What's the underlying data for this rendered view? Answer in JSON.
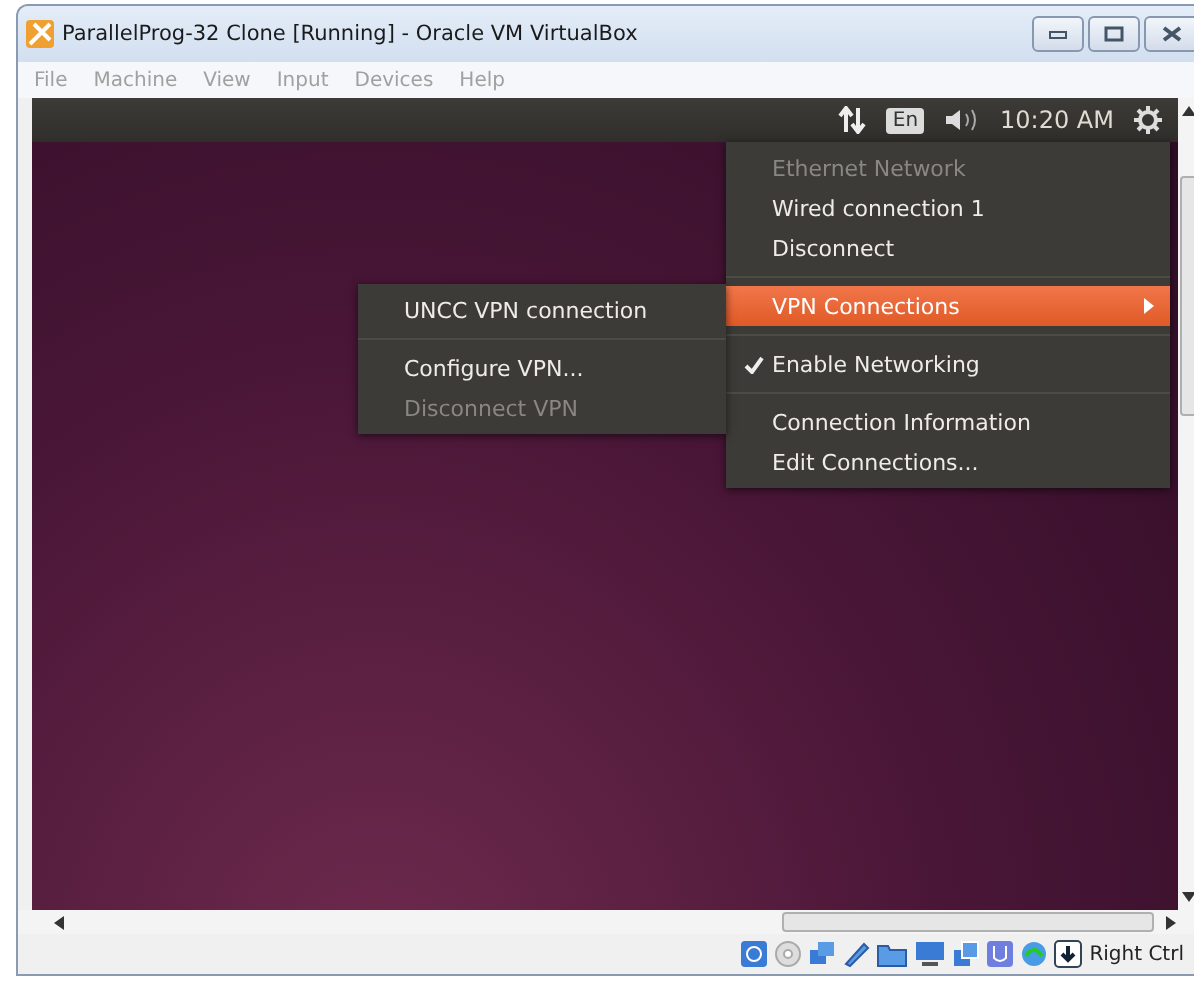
{
  "window": {
    "title": "ParallelProg-32 Clone [Running] - Oracle VM VirtualBox"
  },
  "menubar": [
    "File",
    "Machine",
    "View",
    "Input",
    "Devices",
    "Help"
  ],
  "panel": {
    "keyboard_layout": "En",
    "clock": "10:20 AM"
  },
  "network_menu": [
    {
      "kind": "item",
      "label": "Ethernet Network",
      "disabled": true,
      "selected": false,
      "checked": false,
      "submenu": false
    },
    {
      "kind": "item",
      "label": "Wired connection 1",
      "disabled": false,
      "selected": false,
      "checked": false,
      "submenu": false
    },
    {
      "kind": "item",
      "label": "Disconnect",
      "disabled": false,
      "selected": false,
      "checked": false,
      "submenu": false
    },
    {
      "kind": "separator"
    },
    {
      "kind": "item",
      "label": "VPN Connections",
      "disabled": false,
      "selected": true,
      "checked": false,
      "submenu": true
    },
    {
      "kind": "separator"
    },
    {
      "kind": "item",
      "label": "Enable Networking",
      "disabled": false,
      "selected": false,
      "checked": true,
      "submenu": false
    },
    {
      "kind": "separator"
    },
    {
      "kind": "item",
      "label": "Connection Information",
      "disabled": false,
      "selected": false,
      "checked": false,
      "submenu": false
    },
    {
      "kind": "item",
      "label": "Edit Connections...",
      "disabled": false,
      "selected": false,
      "checked": false,
      "submenu": false
    }
  ],
  "vpn_submenu": [
    {
      "kind": "item",
      "label": "UNCC VPN connection",
      "disabled": false,
      "selected": false
    },
    {
      "kind": "separator"
    },
    {
      "kind": "item",
      "label": "Configure VPN...",
      "disabled": false,
      "selected": false
    },
    {
      "kind": "item",
      "label": "Disconnect VPN",
      "disabled": true,
      "selected": false
    }
  ],
  "status_bar": {
    "host_key": "Right Ctrl"
  }
}
